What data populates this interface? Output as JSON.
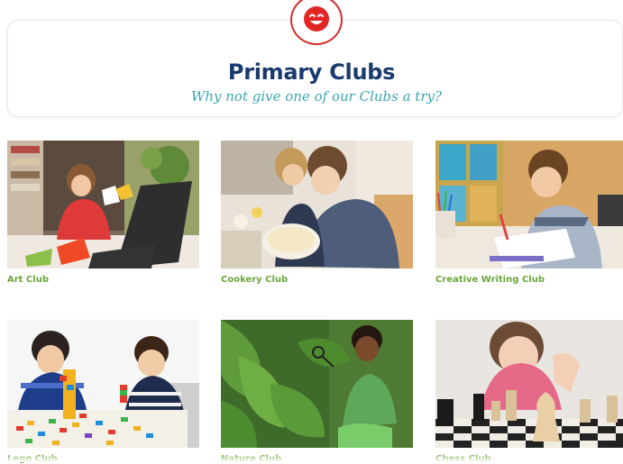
{
  "header": {
    "title": "Primary Clubs",
    "subtitle": "Why not give one of our Clubs a try?",
    "badge_icon": "smiley-icon"
  },
  "clubs": [
    {
      "label": "Art Club",
      "icon": "art-club-photo"
    },
    {
      "label": "Cookery Club",
      "icon": "cookery-club-photo"
    },
    {
      "label": "Creative Writing Club",
      "icon": "creative-writing-club-photo"
    },
    {
      "label": "Lego Club",
      "icon": "lego-club-photo"
    },
    {
      "label": "Nature Club",
      "icon": "nature-club-photo"
    },
    {
      "label": "Chess Club",
      "icon": "chess-club-photo"
    }
  ],
  "colors": {
    "title": "#1a3a6e",
    "subtitle": "#3ba5b5",
    "label": "#6aa53a",
    "badge": "#d32b2b"
  }
}
